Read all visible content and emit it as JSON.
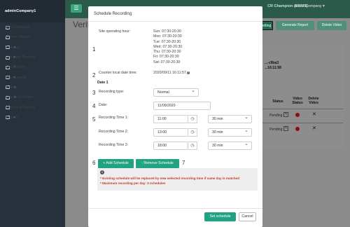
{
  "sidebar": {
    "company": "adminCompany1",
    "items": [
      {
        "label": "My Dashboard",
        "chevron": false
      },
      {
        "label": "Custom Report",
        "chevron": false
      },
      {
        "label": "Analytics",
        "chevron": true
      },
      {
        "label": "Company Reports",
        "chevron": true
      },
      {
        "label": "Site Reports",
        "chevron": true
      },
      {
        "label": "Maintenance",
        "chevron": true
      },
      {
        "label": "Setting",
        "chevron": true
      },
      {
        "label": "Resource Center",
        "chevron": true
      },
      {
        "label": "Marketing Tracker",
        "chevron": false
      },
      {
        "label": "Product",
        "chevron": true
      }
    ]
  },
  "topbar": {
    "menu_icon": "☰",
    "user_green": "CR Champion (R1373)",
    "user": "adminCompany ▾"
  },
  "page": {
    "title": "Verify",
    "buttons": [
      "Setting",
      "Generate Report",
      "Delete Video"
    ],
    "id_line1": "...-c9ba3",
    "id_line2": "...16:11:58",
    "table_headers": [
      "Status",
      "Video Status",
      "Delete Video"
    ],
    "rows": [
      {
        "status": "Pending"
      },
      {
        "status": "Pending"
      }
    ]
  },
  "modal": {
    "title": "Schedule Recording",
    "site_hours_label": "Site operating hour:",
    "site_hours": [
      "Sun: 07:30-20:30",
      "Mon: 07:30-20:30",
      "Tue: 07:30-20:30",
      "Wed: 07:30-20:30",
      "Thu: 07:30-20:30",
      "Fri: 07:30-20:30",
      "Sat: 07:30-20:30"
    ],
    "counter_label": "Counter local date time:",
    "counter_value": "2020/09/11 16:11:57",
    "date_section": "Date 1",
    "recording_type_label": "Recording type:",
    "recording_type_value": "Normal",
    "date_label": "Date:",
    "date_value": "11/09/2020",
    "recording_times": [
      {
        "label": "Recording Time 1:",
        "time": "11:00",
        "duration": "30 min"
      },
      {
        "label": "Recording Time 2:",
        "time": "13:00",
        "duration": "30 min"
      },
      {
        "label": "Recording Time 3:",
        "time": "18:00",
        "duration": "30 min"
      }
    ],
    "add_schedule": "+ Add Schedule",
    "remove_schedule": "- Remove Schedule",
    "notes": [
      "* Existing schedule will be replaced by new selected recording time if same day is matched",
      "* Maximum recording per day: 3 schedules"
    ],
    "set_schedule": "Set schedule",
    "cancel": "Cancel"
  },
  "annotations": [
    "1",
    "2",
    "3",
    "4",
    "5",
    "6",
    "7"
  ],
  "colors": {
    "accent": "#21a383",
    "sidebar": "#27313c",
    "warning_text": "#c0392b"
  }
}
